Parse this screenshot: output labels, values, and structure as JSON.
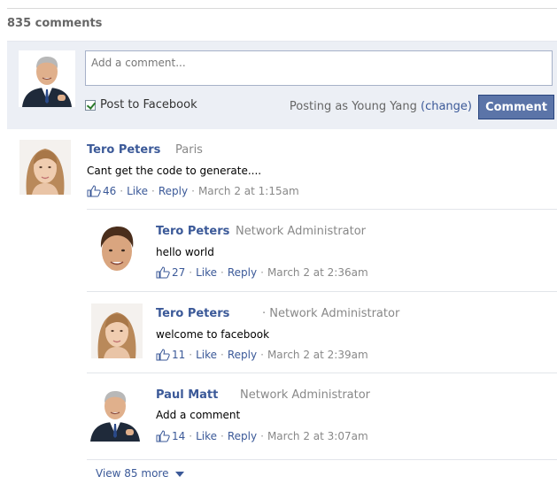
{
  "header": {
    "comment_count": "835 comments"
  },
  "compose": {
    "placeholder": "Add a comment...",
    "post_to_label": "Post to Facebook",
    "post_to_checked": true,
    "posting_as": "Posting as Young Yang",
    "change_link": "(change)",
    "submit_label": "Comment"
  },
  "comments": [
    {
      "name": "Tero Peters",
      "subtitle": "Paris",
      "text": "Cant get the code to generate....",
      "likes": "46",
      "like": "Like",
      "reply": "Reply",
      "time": "March 2 at 1:15am",
      "avatar": "female-avatar"
    },
    {
      "name": "Tero Peters",
      "subtitle": "Network Administrator",
      "text": "hello world",
      "likes": "27",
      "like": "Like",
      "reply": "Reply",
      "time": "March 2 at 2:36am",
      "avatar": "male-avatar"
    },
    {
      "name": "Tero Peters",
      "subtitle": "· Network Administrator",
      "text": "welcome to facebook",
      "likes": "11",
      "like": "Like",
      "reply": "Reply",
      "time": "March 2 at 2:39am",
      "avatar": "female-avatar"
    },
    {
      "name": "Paul Matt",
      "subtitle": "Network Administrator",
      "text": "Add a comment",
      "likes": "14",
      "like": "Like",
      "reply": "Reply",
      "time": "March 2 at 3:07am",
      "avatar": "businessman-avatar"
    }
  ],
  "footer": {
    "view_more": "View 85 more"
  },
  "colors": {
    "link": "#3b5998",
    "button": "#5b74a8",
    "compose_bg": "#eceff5"
  }
}
